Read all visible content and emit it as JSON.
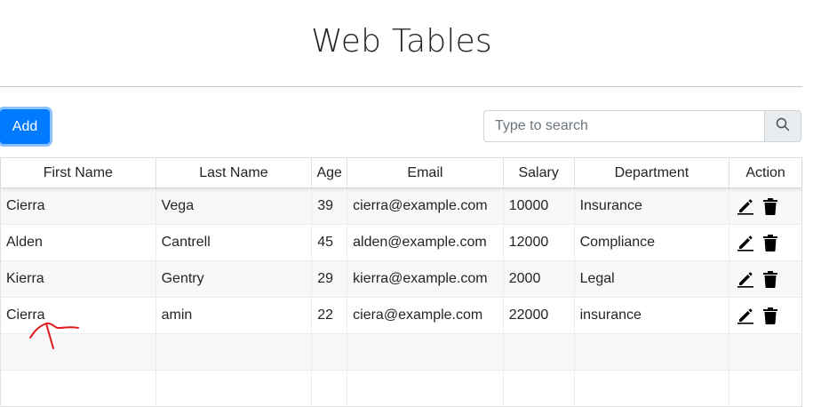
{
  "page": {
    "title": "Web Tables"
  },
  "toolbar": {
    "add_label": "Add"
  },
  "search": {
    "placeholder": "Type to search",
    "value": ""
  },
  "table": {
    "headers": [
      "First Name",
      "Last Name",
      "Age",
      "Email",
      "Salary",
      "Department",
      "Action"
    ],
    "rows": [
      [
        "Cierra",
        "Vega",
        "39",
        "cierra@example.com",
        "10000",
        "Insurance"
      ],
      [
        "Alden",
        "Cantrell",
        "45",
        "alden@example.com",
        "12000",
        "Compliance"
      ],
      [
        "Kierra",
        "Gentry",
        "29",
        "kierra@example.com",
        "2000",
        "Legal"
      ],
      [
        "Cierra",
        "amin",
        "22",
        "ciera@example.com",
        "22000",
        "insurance"
      ]
    ],
    "empty_rows": 2,
    "action_icons": [
      "edit-icon",
      "delete-icon"
    ]
  },
  "colors": {
    "accent": "#007bff",
    "annotation": "#e0191d",
    "row_alt": "#f8f8f8"
  }
}
